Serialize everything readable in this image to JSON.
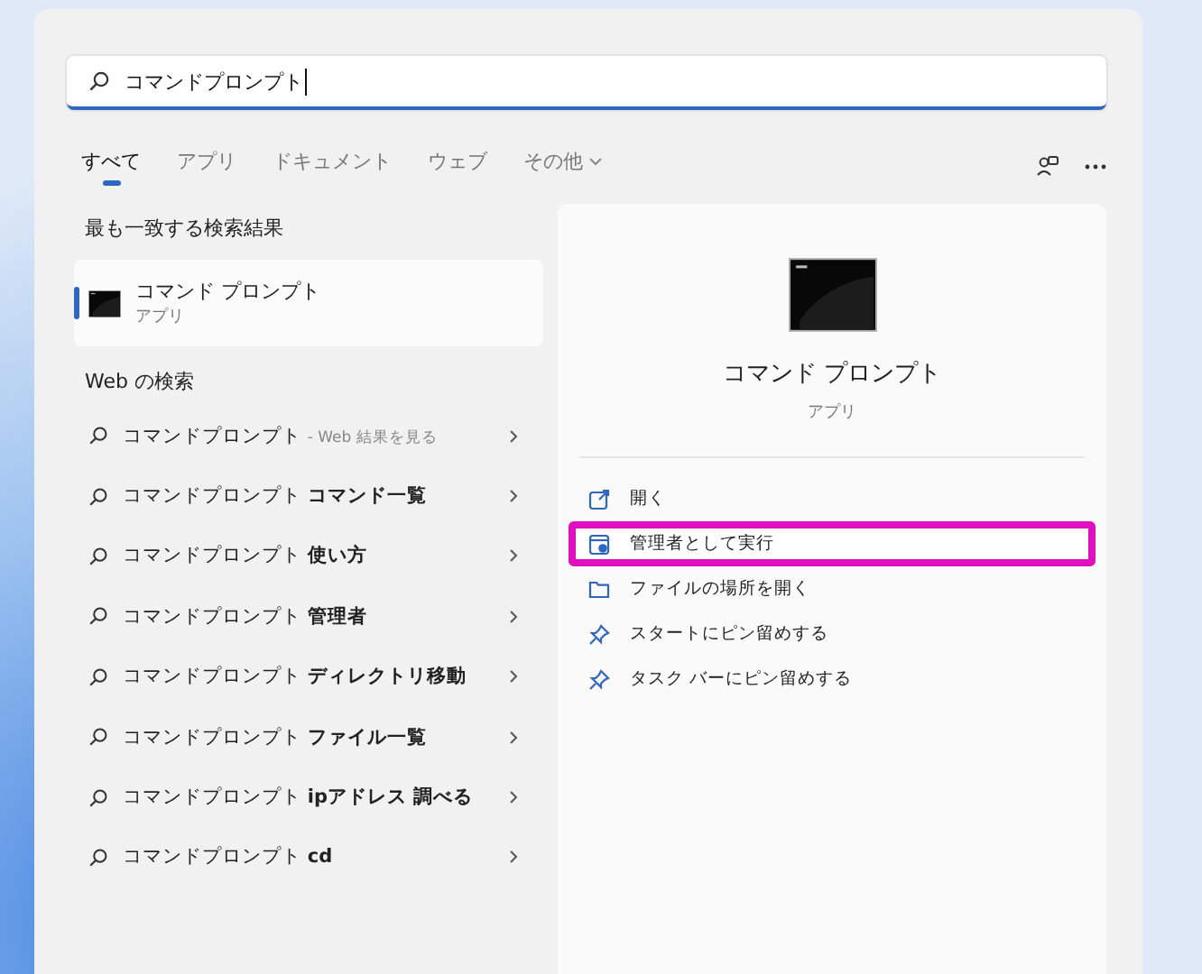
{
  "search": {
    "value": "コマンドプロンプト"
  },
  "tabs": [
    {
      "label": "すべて",
      "selected": true,
      "dropdown": false
    },
    {
      "label": "アプリ",
      "selected": false,
      "dropdown": false
    },
    {
      "label": "ドキュメント",
      "selected": false,
      "dropdown": false
    },
    {
      "label": "ウェブ",
      "selected": false,
      "dropdown": false
    },
    {
      "label": "その他",
      "selected": false,
      "dropdown": true
    }
  ],
  "best_match": {
    "heading": "最も一致する検索結果",
    "title": "コマンド プロンプト",
    "subtitle": "アプリ",
    "selected": true
  },
  "web": {
    "heading": "Web の検索",
    "items": [
      {
        "query": "コマンドプロンプト",
        "suffix": "- Web 結果を見る",
        "kind": "web"
      },
      {
        "query": "コマンドプロンプト",
        "suffix": "コマンド一覧",
        "kind": "suggestion"
      },
      {
        "query": "コマンドプロンプト",
        "suffix": "使い方",
        "kind": "suggestion"
      },
      {
        "query": "コマンドプロンプト",
        "suffix": "管理者",
        "kind": "suggestion"
      },
      {
        "query": "コマンドプロンプト",
        "suffix": "ディレクトリ移動",
        "kind": "suggestion"
      },
      {
        "query": "コマンドプロンプト",
        "suffix": "ファイル一覧",
        "kind": "suggestion"
      },
      {
        "query": "コマンドプロンプト",
        "suffix": "ipアドレス 調べる",
        "kind": "suggestion"
      },
      {
        "query": "コマンドプロンプト",
        "suffix": "cd",
        "kind": "suggestion"
      }
    ]
  },
  "detail": {
    "title": "コマンド プロンプト",
    "subtitle": "アプリ",
    "actions": [
      {
        "label": "開く",
        "kind": "open",
        "highlighted": false
      },
      {
        "label": "管理者として実行",
        "kind": "admin",
        "highlighted": true
      },
      {
        "label": "ファイルの場所を開く",
        "kind": "folder",
        "highlighted": false
      },
      {
        "label": "スタートにピン留めする",
        "kind": "pin",
        "highlighted": false
      },
      {
        "label": "タスク バーにピン留めする",
        "kind": "pin",
        "highlighted": false
      }
    ]
  }
}
